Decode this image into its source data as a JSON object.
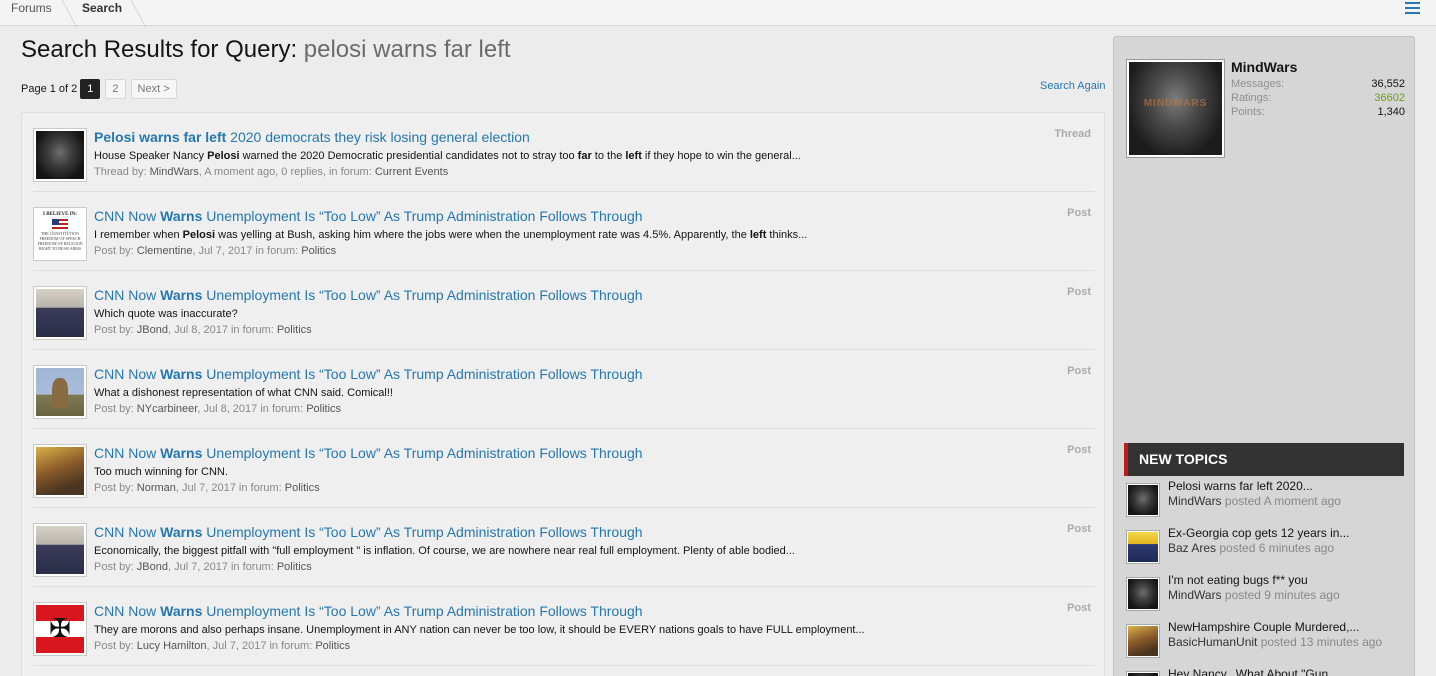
{
  "breadcrumb": {
    "forums": "Forums",
    "search": "Search"
  },
  "heading": {
    "prefix": "Search Results for Query: ",
    "query": "pelosi warns far left"
  },
  "pagination": {
    "label": "Page 1 of 2",
    "pages": [
      "1",
      "2"
    ],
    "current": "1",
    "next": "Next >"
  },
  "search_again": "Search Again",
  "results": [
    {
      "title_parts": [
        [
          "Pelosi",
          true
        ],
        [
          " ",
          false
        ],
        [
          "warns",
          true
        ],
        [
          " ",
          false
        ],
        [
          "far",
          true
        ],
        [
          " ",
          false
        ],
        [
          "left",
          true
        ],
        [
          " 2020 democrats they risk losing general election",
          false
        ]
      ],
      "snippet_parts": [
        [
          "House Speaker Nancy ",
          false
        ],
        [
          "Pelosi",
          true
        ],
        [
          " warned the 2020 Democratic presidential candidates not to stray too ",
          false
        ],
        [
          "far",
          true
        ],
        [
          " to the ",
          false
        ],
        [
          "left",
          true
        ],
        [
          " if they hope to win the general...",
          false
        ]
      ],
      "meta_prefix": "Thread by: ",
      "author": "MindWars",
      "meta_mid": ", A moment ago, 0 replies, in forum: ",
      "forum": "Current Events",
      "type": "Thread",
      "avatar": "dark-face-icon"
    },
    {
      "title_parts": [
        [
          "CNN Now ",
          false
        ],
        [
          "Warns",
          true
        ],
        [
          " Unemployment Is “Too Low” As Trump Administration Follows Through",
          false
        ]
      ],
      "snippet_parts": [
        [
          "I remember when ",
          false
        ],
        [
          "Pelosi",
          true
        ],
        [
          " was yelling at Bush, asking him where the jobs were when the unemployment rate was 4.5%. Apparently, the ",
          false
        ],
        [
          "left",
          true
        ],
        [
          " thinks...",
          false
        ]
      ],
      "meta_prefix": "Post by: ",
      "author": "Clementine",
      "meta_mid": ", Jul 7, 2017 in forum: ",
      "forum": "Politics",
      "type": "Post",
      "avatar": "creed-poster-icon",
      "avatar_text": {
        "top": "I BELIEVE IN:",
        "bottom": "THE CONSTITUTION FREEDOM OF SPEECH FREEDOM OF RELIGION RIGHT TO BEAR ARMS"
      }
    },
    {
      "title_parts": [
        [
          "CNN Now ",
          false
        ],
        [
          "Warns",
          true
        ],
        [
          " Unemployment Is “Too Low” As Trump Administration Follows Through",
          false
        ]
      ],
      "snippet_parts": [
        [
          "Which quote was inaccurate?",
          false
        ]
      ],
      "meta_prefix": "Post by: ",
      "author": "JBond",
      "meta_mid": ", Jul 8, 2017 in forum: ",
      "forum": "Politics",
      "type": "Post",
      "avatar": "dusk-landscape-icon"
    },
    {
      "title_parts": [
        [
          "CNN Now ",
          false
        ],
        [
          "Warns",
          true
        ],
        [
          " Unemployment Is “Too Low” As Trump Administration Follows Through",
          false
        ]
      ],
      "snippet_parts": [
        [
          "What a dishonest representation of what CNN said. Comical!!",
          false
        ]
      ],
      "meta_prefix": "Post by: ",
      "author": "NYcarbineer",
      "meta_mid": ", Jul 8, 2017 in forum: ",
      "forum": "Politics",
      "type": "Post",
      "avatar": "deer-icon"
    },
    {
      "title_parts": [
        [
          "CNN Now ",
          false
        ],
        [
          "Warns",
          true
        ],
        [
          " Unemployment Is “Too Low” As Trump Administration Follows Through",
          false
        ]
      ],
      "snippet_parts": [
        [
          "Too much winning for CNN.",
          false
        ]
      ],
      "meta_prefix": "Post by: ",
      "author": "Norman",
      "meta_mid": ", Jul 7, 2017 in forum: ",
      "forum": "Politics",
      "type": "Post",
      "avatar": "painting-icon"
    },
    {
      "title_parts": [
        [
          "CNN Now ",
          false
        ],
        [
          "Warns",
          true
        ],
        [
          " Unemployment Is “Too Low” As Trump Administration Follows Through",
          false
        ]
      ],
      "snippet_parts": [
        [
          "Economically, the biggest pitfall with \"full employment \" is inflation. Of course, we are nowhere near real full employment. Plenty of able bodied...",
          false
        ]
      ],
      "meta_prefix": "Post by: ",
      "author": "JBond",
      "meta_mid": ", Jul 7, 2017 in forum: ",
      "forum": "Politics",
      "type": "Post",
      "avatar": "dusk-landscape-icon"
    },
    {
      "title_parts": [
        [
          "CNN Now ",
          false
        ],
        [
          "Warns",
          true
        ],
        [
          " Unemployment Is “Too Low” As Trump Administration Follows Through",
          false
        ]
      ],
      "snippet_parts": [
        [
          "They are morons and also perhaps insane. Unemployment in ANY nation can never be too low, it should be EVERY nations goals to have FULL employment...",
          false
        ]
      ],
      "meta_prefix": "Post by: ",
      "author": "Lucy Hamilton",
      "meta_mid": ", Jul 7, 2017 in forum: ",
      "forum": "Politics",
      "type": "Post",
      "avatar": "austrian-flag-icon"
    }
  ],
  "visitor": {
    "name": "MindWars",
    "stats": [
      {
        "label": "Messages:",
        "value": "36,552"
      },
      {
        "label": "Ratings:",
        "value": "36602"
      },
      {
        "label": "Points:",
        "value": "1,340"
      }
    ]
  },
  "new_topics": {
    "header": "NEW TOPICS",
    "items": [
      {
        "title": "Pelosi warns far left 2020...",
        "user": "MindWars",
        "posted": " posted A moment ago",
        "avatar": "dark-face-icon"
      },
      {
        "title": "Ex-Georgia cop gets 12 years in...",
        "user": "Baz Ares",
        "posted": " posted 6 minutes ago",
        "avatar": "baz-ares-icon"
      },
      {
        "title": "I'm not eating bugs f** you",
        "user": "MindWars",
        "posted": " posted 9 minutes ago",
        "avatar": "dark-face-icon"
      },
      {
        "title": "NewHampshire Couple Murdered,...",
        "user": "BasicHumanUnit",
        "posted": " posted 13 minutes ago",
        "avatar": "painting-icon"
      },
      {
        "title": "Hey Nancy...What About \"Gun...",
        "user": "",
        "posted": "",
        "avatar": "dark-face-icon"
      }
    ]
  },
  "colors": {
    "link": "#2577b1",
    "accent_red": "#c21a1a",
    "rating_green": "#6a9e1f"
  }
}
